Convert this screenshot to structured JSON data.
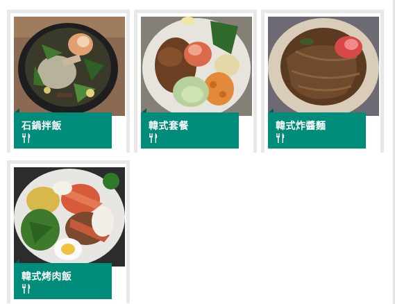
{
  "menu": {
    "items": [
      {
        "name": "石鍋拌飯",
        "icon": "utensils-icon"
      },
      {
        "name": "韓式套餐",
        "icon": "utensils-icon"
      },
      {
        "name": "韓式炸醬麵",
        "icon": "utensils-icon"
      },
      {
        "name": "韓式烤肉飯",
        "icon": "utensils-icon"
      }
    ],
    "label_color": "#008c7a",
    "card_border_color": "#e8e8e8"
  }
}
